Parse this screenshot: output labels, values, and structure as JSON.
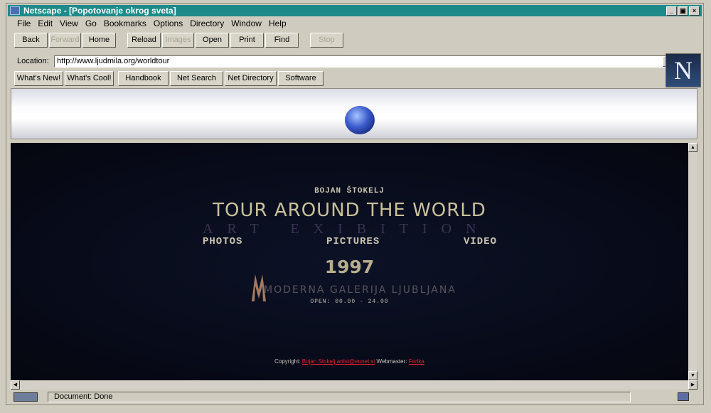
{
  "window": {
    "title": "Netscape - [Popotovanje okrog sveta]",
    "controls": [
      "_",
      "▣",
      "×"
    ]
  },
  "menu": [
    "File",
    "Edit",
    "View",
    "Go",
    "Bookmarks",
    "Options",
    "Directory",
    "Window",
    "Help"
  ],
  "toolbar": {
    "buttons": [
      {
        "label": "Back",
        "enabled": true
      },
      {
        "label": "Forward",
        "enabled": false
      },
      {
        "label": "Home",
        "enabled": true
      },
      {
        "label": "Reload",
        "enabled": true
      },
      {
        "label": "Images",
        "enabled": false
      },
      {
        "label": "Open",
        "enabled": true
      },
      {
        "label": "Print",
        "enabled": true
      },
      {
        "label": "Find",
        "enabled": true
      },
      {
        "label": "Stop",
        "enabled": false
      }
    ]
  },
  "location": {
    "label": "Location:",
    "url": "http://www.ljudmila.org/worldtour"
  },
  "directory_buttons": [
    "What's New!",
    "What's Cool!",
    "Handbook",
    "Net Search",
    "Net Directory",
    "Software"
  ],
  "logo": {
    "letter": "N"
  },
  "page": {
    "author": "BOJAN ŠTOKELJ",
    "headline": "TOUR AROUND THE WORLD",
    "subtitle": "ART EXIBITION",
    "categories": [
      "PHOTOS",
      "PICTURES",
      "VIDEO"
    ],
    "year": "1997",
    "museum": "MODERNA GALERIJA LJUBLJANA",
    "hours": "OPEN: 00.00 - 24.00",
    "footer": {
      "copyright_label": "Copyright:",
      "copyright_link": "Bojan Stokelj artist@eunet.si",
      "webmaster_label": "Webmaster:",
      "webmaster_link": "Ferlka"
    }
  },
  "status": {
    "text": "Document: Done"
  },
  "colors": {
    "titlebar": "#1e8a8a",
    "page_bg": "#070a17",
    "link": "#e0232d",
    "headline": "#c9c09a"
  }
}
